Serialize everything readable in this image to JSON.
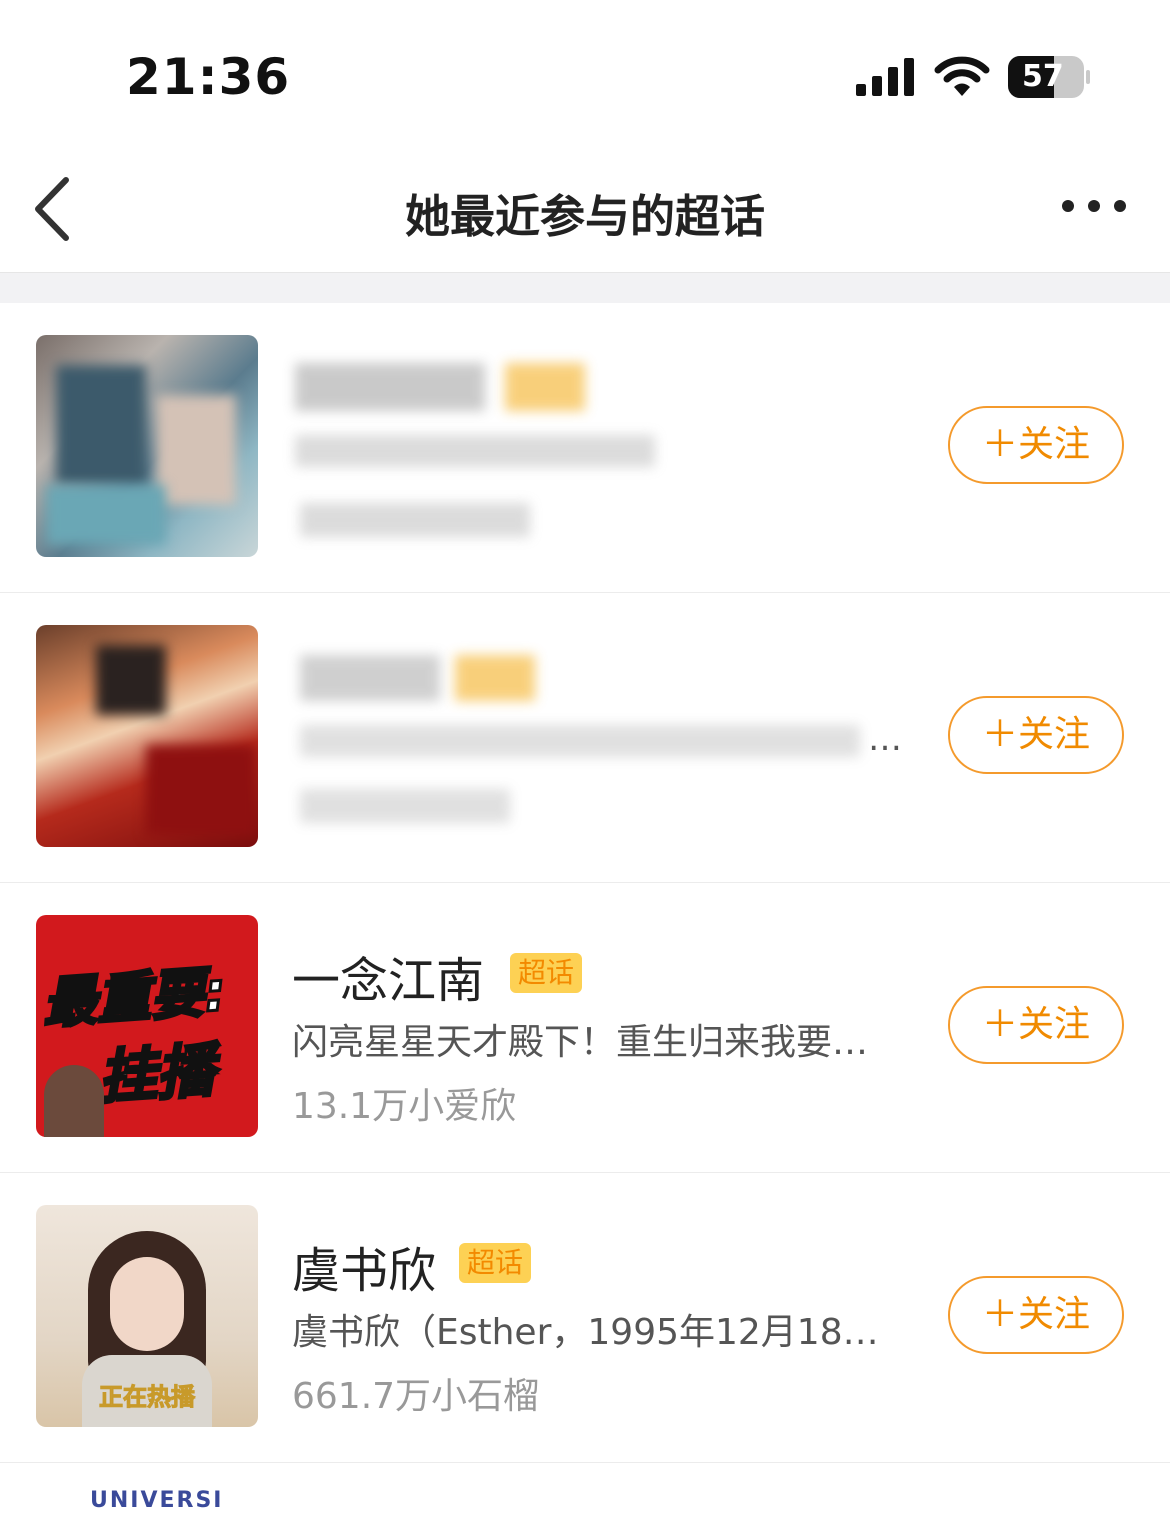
{
  "status_bar": {
    "time": "21:36",
    "battery": "57"
  },
  "nav": {
    "title": "她最近参与的超话"
  },
  "badge_label": "超话",
  "items": [
    {
      "title": "",
      "desc": "",
      "fans": "",
      "follow": "＋关注"
    },
    {
      "title": "",
      "desc": "…",
      "fans": "",
      "follow": "＋关注"
    },
    {
      "title": "一念江南",
      "desc": "闪亮星星天才殿下！重生归来我要…",
      "fans": "13.1万小爱欣",
      "follow": "＋关注",
      "cover_text_1": "最重要:",
      "cover_text_2": "挂播"
    },
    {
      "title": "虞书欣",
      "desc": "虞书欣（Esther，1995年12月18…",
      "fans": "661.7万小石榴",
      "follow": "＋关注",
      "cover_text": "正在热播"
    }
  ],
  "peek_text": "UNIVERSI"
}
